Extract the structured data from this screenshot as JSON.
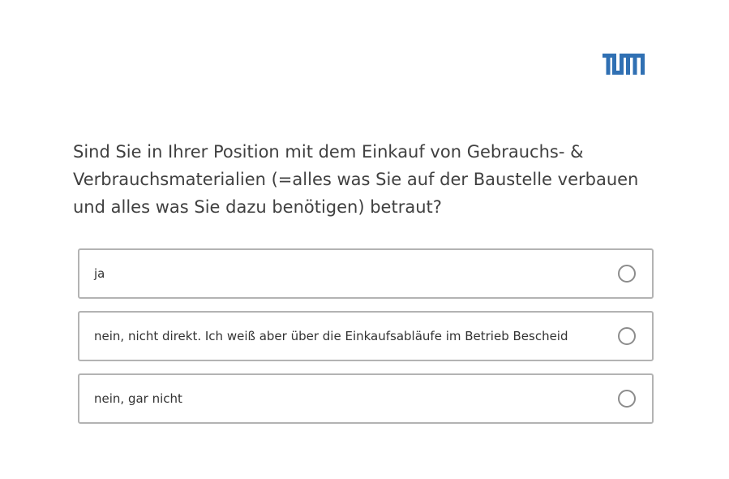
{
  "logo": {
    "icon": "tum-logo-icon",
    "text": "TUM",
    "color": "#3070b3"
  },
  "question": {
    "text": "Sind Sie in Ihrer Position mit dem Einkauf von Gebrauchs- & Verbrauchsmaterialien (=alles was Sie auf der Baustelle verbauen und alles was Sie dazu benötigen) betraut?"
  },
  "options": [
    {
      "label": "ja",
      "selected": false
    },
    {
      "label": "nein, nicht direkt. Ich weiß aber über die Einkaufsabläufe im Betrieb Bescheid",
      "selected": false
    },
    {
      "label": "nein, gar nicht",
      "selected": false
    }
  ]
}
